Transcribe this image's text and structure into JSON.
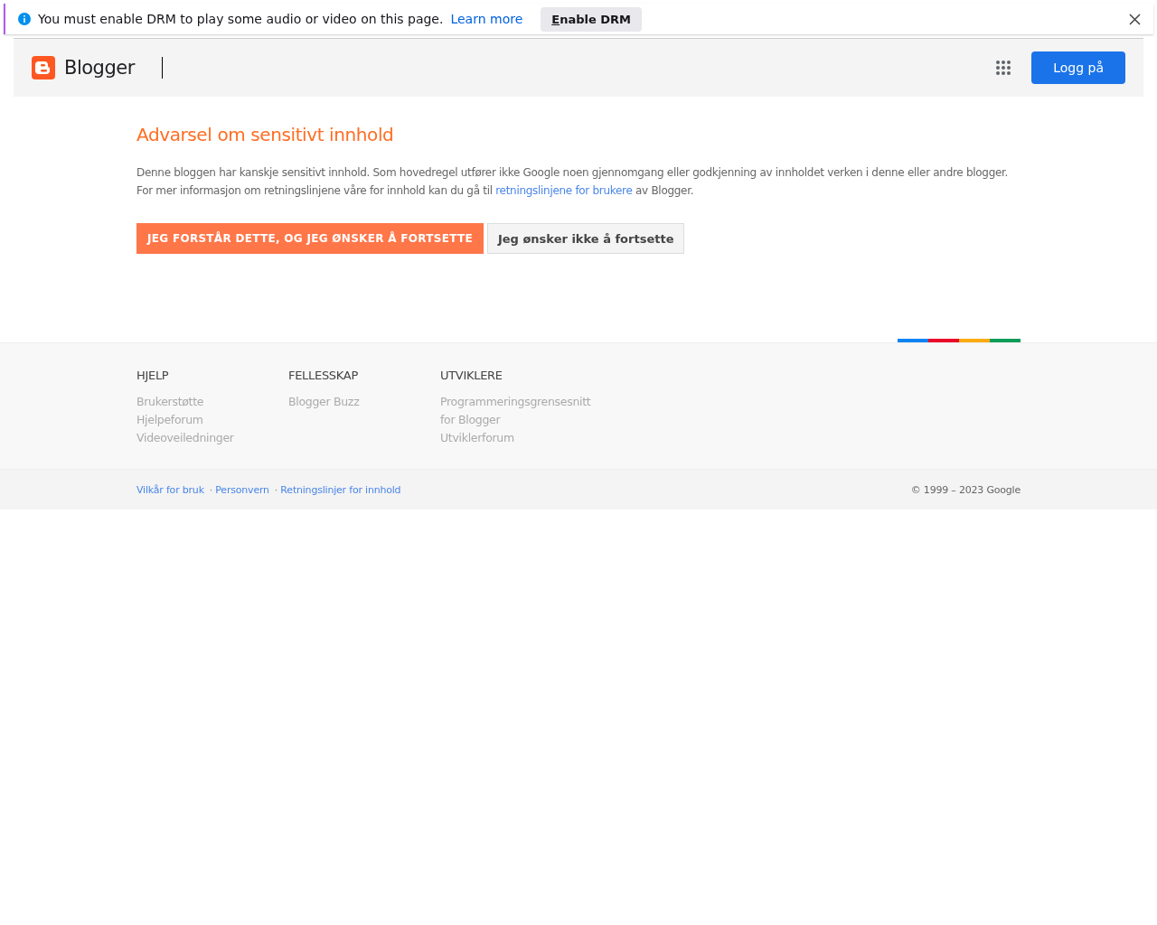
{
  "notification_bar": {
    "message": "You must enable DRM to play some audio or video on this page.",
    "link": "Learn more",
    "button_access_key": "E",
    "button_rest": "nable DRM"
  },
  "header": {
    "brand": "Blogger",
    "sign_in": "Logg på"
  },
  "warning": {
    "title": "Advarsel om sensitivt innhold",
    "line_1": "Denne bloggen har kanskje sensitivt innhold. Som hovedregel utfører ikke Google noen gjennomgang eller godkjenning av innholdet verken i denne eller andre blogger.",
    "line_2_before": "For mer informasjon om retningslinjene våre for innhold kan du gå til",
    "line_2_link": "retningslinjene for brukere",
    "line_2_after": "av Blogger.",
    "accept": "JEG FORSTÅR DETTE, OG JEG ØNSKER Å FORTSETTE",
    "decline": "Jeg ønsker ikke å fortsette"
  },
  "footer": {
    "columns": [
      {
        "heading": "HJELP",
        "links": [
          "Brukerstøtte",
          "Hjelpeforum",
          "Videoveiledninger"
        ]
      },
      {
        "heading": "FELLESSKAP",
        "links": [
          "Blogger Buzz"
        ]
      },
      {
        "heading": "UTVIKLERE",
        "links": [
          "Programmeringsgrensesnitt for Blogger",
          "Utviklerforum"
        ]
      }
    ],
    "bottom_links": [
      {
        "label": "Vilkår for bruk"
      },
      {
        "separator": "·",
        "label": "Personvern"
      },
      {
        "separator": "·",
        "label": "Retningslinjer for innhold"
      }
    ],
    "copyright": "© 1999 – 2023 Google"
  }
}
